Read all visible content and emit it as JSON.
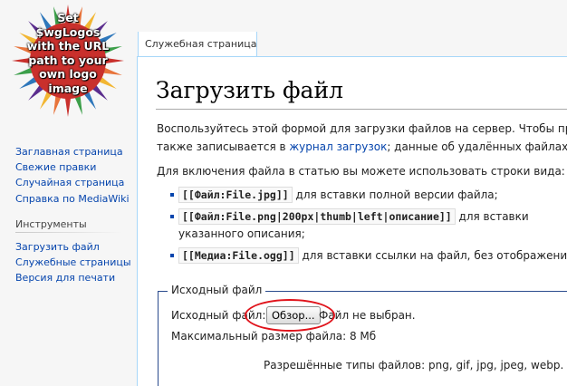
{
  "logo": {
    "text": "Set\n$wgLogos\nwith the URL\npath to your\nown logo\nimage",
    "colors": [
      "#c9302c",
      "#e8743b",
      "#f2b632",
      "#5b2d8e",
      "#2e77bb",
      "#3c9f4a"
    ]
  },
  "sidebar": {
    "nav_items": [
      {
        "label": "Заглавная страница"
      },
      {
        "label": "Свежие правки"
      },
      {
        "label": "Случайная страница"
      },
      {
        "label": "Справка по MediaWiki"
      }
    ],
    "tools_heading": "Инструменты",
    "tool_items": [
      {
        "label": "Загрузить файл"
      },
      {
        "label": "Служебные страницы"
      },
      {
        "label": "Версия для печати"
      }
    ]
  },
  "tab": {
    "label": "Служебная страница"
  },
  "page": {
    "title": "Загрузить файл",
    "intro_line1": "Воспользуйтесь этой формой для загрузки файлов на сервер. Чтобы просм",
    "intro_line2_before": "также записывается в ",
    "intro_link": "журнал загрузок",
    "intro_line2_after": "; данные об удалённых файлах мож",
    "include_text": "Для включения файла в статью вы можете использовать строки вида:",
    "list": [
      {
        "code": "[[Файл:File.jpg]]",
        "text": " для вставки полной версии файла;"
      },
      {
        "code": "[[Файл:File.png|200px|thumb|left|описание]]",
        "text": " для вставки",
        "cont": "указанного описания;"
      },
      {
        "code": "[[Медиа:File.ogg]]",
        "text": " для вставки ссылки на файл, без отображения"
      }
    ]
  },
  "form": {
    "legend": "Исходный файл",
    "source_label": "Исходный файл:",
    "browse_label": "Обзор...",
    "no_file_text": "Файл не выбран.",
    "max_size": "Максимальный размер файла: 8 Мб",
    "allowed_types": "Разрешённые типы файлов: png, gif, jpg, jpeg, webp."
  },
  "annotation": {
    "color": "#e0131b"
  }
}
